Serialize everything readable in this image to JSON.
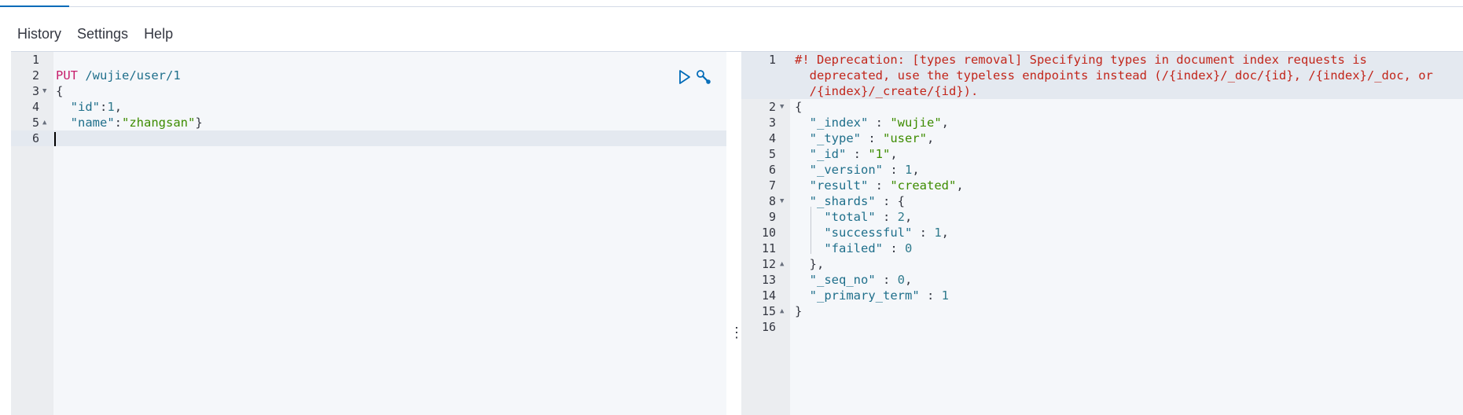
{
  "menu": {
    "items": [
      "History",
      "Settings",
      "Help"
    ]
  },
  "colors": {
    "accent": "#006bb8",
    "method": "#c71f6c",
    "string": "#3d8c00",
    "key": "#1f6f8b",
    "warning": "#c2261b"
  },
  "request": {
    "lines": [
      {
        "n": "1",
        "text": ""
      },
      {
        "n": "2",
        "method": "PUT",
        "path": "/wujie/user/1"
      },
      {
        "n": "3",
        "text": "{"
      },
      {
        "n": "4",
        "key": "\"id\"",
        "sep": ":",
        "value": "1",
        "trail": ","
      },
      {
        "n": "5",
        "key": "\"name\"",
        "sep": ":",
        "value": "\"zhangsan\"",
        "trail": "}"
      },
      {
        "n": "6",
        "text": ""
      }
    ],
    "actions": {
      "run_icon": "play-icon",
      "settings_icon": "wrench-icon"
    }
  },
  "response": {
    "warning": "#! Deprecation: [types removal] Specifying types in document index requests is\n  deprecated, use the typeless endpoints instead (/{index}/_doc/{id}, /{index}/_doc, or\n  /{index}/_create/{id}).",
    "lines": [
      {
        "n": "1"
      },
      {
        "n": "2",
        "text": "{"
      },
      {
        "n": "3",
        "key": "\"_index\"",
        "value": "\"wujie\"",
        "trail": ","
      },
      {
        "n": "4",
        "key": "\"_type\"",
        "value": "\"user\"",
        "trail": ","
      },
      {
        "n": "5",
        "key": "\"_id\"",
        "value": "\"1\"",
        "trail": ","
      },
      {
        "n": "6",
        "key": "\"_version\"",
        "value": "1",
        "trail": ","
      },
      {
        "n": "7",
        "key": "\"result\"",
        "value": "\"created\"",
        "trail": ","
      },
      {
        "n": "8",
        "key": "\"_shards\"",
        "value": "{",
        "trail": ""
      },
      {
        "n": "9",
        "key": "\"total\"",
        "value": "2",
        "trail": ","
      },
      {
        "n": "10",
        "key": "\"successful\"",
        "value": "1",
        "trail": ","
      },
      {
        "n": "11",
        "key": "\"failed\"",
        "value": "0",
        "trail": ""
      },
      {
        "n": "12",
        "text": "},"
      },
      {
        "n": "13",
        "key": "\"_seq_no\"",
        "value": "0",
        "trail": ","
      },
      {
        "n": "14",
        "key": "\"_primary_term\"",
        "value": "1",
        "trail": ""
      },
      {
        "n": "15",
        "text": "}"
      },
      {
        "n": "16",
        "text": ""
      }
    ],
    "colon": " : "
  },
  "resizer": {
    "icon": "drag-handle-icon",
    "glyph": "⋮"
  }
}
